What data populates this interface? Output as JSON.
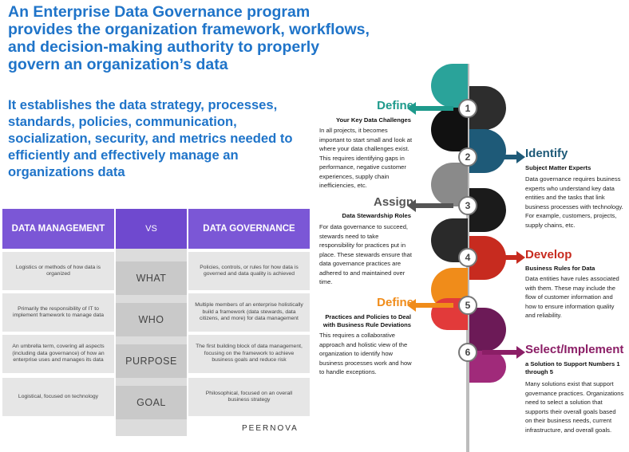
{
  "headline": {
    "lines": [
      "An Enterprise Data Governance program",
      "provides the organization framework, workflows,",
      "and decision-making authority to properly",
      "govern an organization’s data"
    ]
  },
  "subhead": {
    "lines": [
      "It establishes the data strategy, processes,",
      "standards, policies, communication,",
      "socialization, security, and metrics needed to",
      "efficiently and effectively manage an",
      "organizations data"
    ]
  },
  "comparison": {
    "left_header": "DATA MANAGEMENT",
    "vs": "VS",
    "right_header": "DATA GOVERNANCE",
    "rows": [
      {
        "label": "WHAT",
        "left": "Logistics or methods of how data is organized",
        "right": "Policies, controls, or rules for how data is governed and data quality is achieved"
      },
      {
        "label": "WHO",
        "left": "Primarily the responsibility of IT to implement framework to manage data",
        "right": "Multiple members of an enterprise holistically build a framework (data stewards, data citizens, and more) for data management"
      },
      {
        "label": "PURPOSE",
        "left": "An umbrella term, covering all aspects (including data governance) of how an enterprise uses and manages its data",
        "right": "The first building block of data management, focusing on the framework to achieve business goals and reduce risk"
      },
      {
        "label": "GOAL",
        "left": "Logistical, focused on technology",
        "right": "Philosophical, focused on an overall business strategy"
      }
    ],
    "brand": "PEERNOVA"
  },
  "steps": [
    {
      "number": "1",
      "title": "Define",
      "subtitle": "Your Key Data Challenges",
      "body": "In all projects, it becomes important to start small and look at where your data challenges exist. This requires identifying gaps in performance, negative customer experiences, supply chain inefficiencies, etc.",
      "color": "#1e9a8c"
    },
    {
      "number": "2",
      "title": "Identify",
      "subtitle": "Subject Matter Experts",
      "body": "Data governance requires business experts who understand key data entities and the tasks that link business processes with technology. For example, customers, projects, supply chains, etc.",
      "color": "#1e5a78"
    },
    {
      "number": "3",
      "title": "Assign",
      "subtitle": "Data Stewardship Roles",
      "body": "For data governance to succeed, stewards need to take responsibility for practices put in place. These stewards ensure that data governance practices are adhered to and maintained over time.",
      "color": "#555555"
    },
    {
      "number": "4",
      "title": "Develop",
      "subtitle": "Business Rules for Data",
      "body": "Data entities have rules associated with them. These may include the flow of customer information and how to ensure information quality and reliability.",
      "color": "#c72b1f"
    },
    {
      "number": "5",
      "title": "Define",
      "subtitle": "Practices and Policies to Deal with Business Rule Deviations",
      "body": "This requires a collaborative approach and holistic view of the organization to identify how business processes work and how to handle exceptions.",
      "color": "#f08c1a"
    },
    {
      "number": "6",
      "title": "Select/Implement",
      "subtitle": "a Solution to Support Numbers 1 through 5",
      "body": "Many solutions exist that support governance practices. Organizations need to select a solution that supports their overall goals based on their business needs, current infrastructure, and overall goals.",
      "color": "#8b1e66"
    }
  ]
}
